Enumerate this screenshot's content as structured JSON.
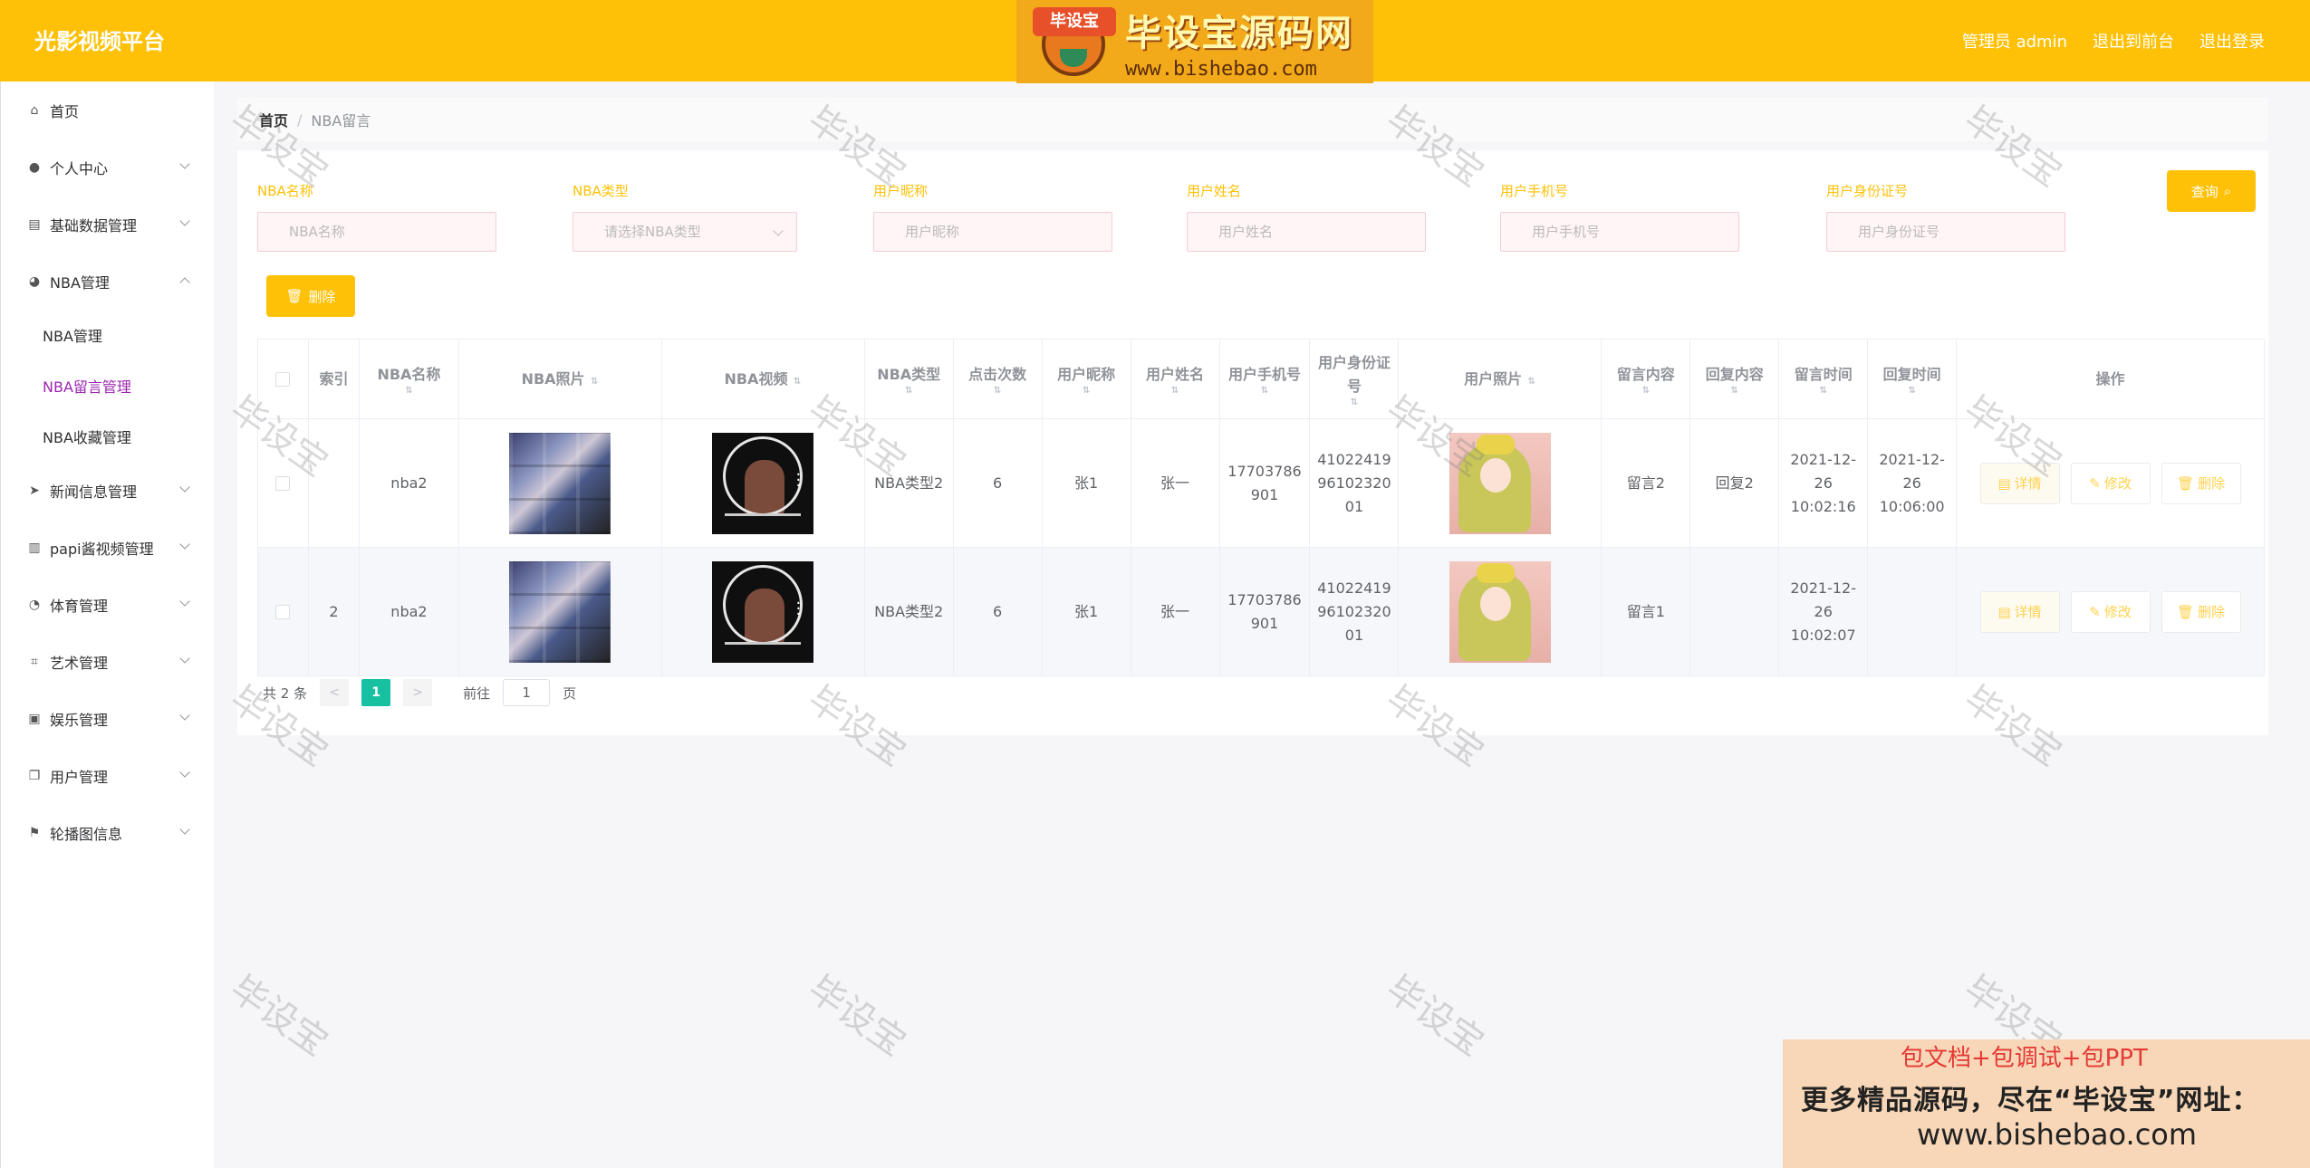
{
  "header": {
    "brand": "光影视频平台",
    "admin_label": "管理员 admin",
    "to_front": "退出到前台",
    "logout": "退出登录"
  },
  "logo_banner": {
    "badge": "毕设宝",
    "title": "毕设宝源码网",
    "url": "www.bishebao.com"
  },
  "sidebar": {
    "items": [
      {
        "label": "首页",
        "icon": "home-icon"
      },
      {
        "label": "个人中心",
        "icon": "user-icon"
      },
      {
        "label": "基础数据管理",
        "icon": "database-icon"
      },
      {
        "label": "NBA管理",
        "icon": "basketball-icon"
      },
      {
        "label": "新闻信息管理",
        "icon": "send-icon"
      },
      {
        "label": "papi酱视频管理",
        "icon": "clipboard-icon"
      },
      {
        "label": "体育管理",
        "icon": "bell-icon"
      },
      {
        "label": "艺术管理",
        "icon": "crop-icon"
      },
      {
        "label": "娱乐管理",
        "icon": "camera-icon"
      },
      {
        "label": "用户管理",
        "icon": "copy-icon"
      },
      {
        "label": "轮播图信息",
        "icon": "flag-icon"
      }
    ],
    "nba_sub": [
      "NBA管理",
      "NBA留言管理",
      "NBA收藏管理"
    ]
  },
  "breadcrumb": {
    "home": "首页",
    "sep": "/",
    "current": "NBA留言"
  },
  "filters": [
    {
      "label": "NBA名称",
      "placeholder": "NBA名称"
    },
    {
      "label": "NBA类型",
      "placeholder": "请选择NBA类型"
    },
    {
      "label": "用户昵称",
      "placeholder": "用户昵称"
    },
    {
      "label": "用户姓名",
      "placeholder": "用户姓名"
    },
    {
      "label": "用户手机号",
      "placeholder": "用户手机号"
    },
    {
      "label": "用户身份证号",
      "placeholder": "用户身份证号"
    }
  ],
  "buttons": {
    "query": "查询",
    "delete": "删除"
  },
  "table": {
    "columns": [
      "索引",
      "NBA名称",
      "NBA照片",
      "NBA视频",
      "NBA类型",
      "点击次数",
      "用户昵称",
      "用户姓名",
      "用户手机号",
      "用户身份证号",
      "用户照片",
      "留言内容",
      "回复内容",
      "留言时间",
      "回复时间",
      "操作"
    ],
    "rows": [
      {
        "index": "",
        "name": "nba2",
        "type": "NBA类型2",
        "clicks": "6",
        "nickname": "张1",
        "realname": "张一",
        "phone": "17703786901",
        "idcard": "410224199610232001",
        "message": "留言2",
        "reply": "回复2",
        "msg_time": "2021-12-26 10:02:16",
        "reply_time": "2021-12-26 10:06:00"
      },
      {
        "index": "2",
        "name": "nba2",
        "type": "NBA类型2",
        "clicks": "6",
        "nickname": "张1",
        "realname": "张一",
        "phone": "17703786901",
        "idcard": "410224199610232001",
        "message": "留言1",
        "reply": "",
        "msg_time": "2021-12-26 10:02:07",
        "reply_time": ""
      }
    ],
    "actions": {
      "detail": "详情",
      "edit": "修改",
      "delete": "删除"
    }
  },
  "pagination": {
    "total": "共 2 条",
    "prev": "<",
    "page": "1",
    "next": ">",
    "goto": "前往",
    "goto_value": "1",
    "page_unit": "页"
  },
  "watermark": "毕设宝",
  "ad": {
    "line1": "包文档+包调试+包PPT",
    "line2": "更多精品源码，尽在“毕设宝”网址：",
    "line3": "www.bishebao.com"
  },
  "colors": {
    "accent": "#ffc107",
    "active_menu": "#9c27b0",
    "page_active": "#16c0a1"
  }
}
